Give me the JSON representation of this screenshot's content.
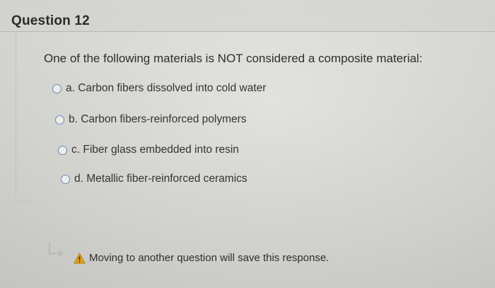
{
  "header": {
    "title": "Question 12"
  },
  "question": {
    "text": "One of the following materials is NOT considered a composite material:"
  },
  "options": [
    {
      "label": "a. Carbon fibers dissolved into cold water"
    },
    {
      "label": "b. Carbon fibers-reinforced polymers"
    },
    {
      "label": "c. Fiber glass embedded into resin"
    },
    {
      "label": "d. Metallic fiber-reinforced ceramics"
    }
  ],
  "footer": {
    "note": "Moving to another question will save this response.",
    "arrow_icon": "curved-arrow-icon",
    "warning_icon": "warning-icon",
    "warning_color": "#e0a21a"
  }
}
